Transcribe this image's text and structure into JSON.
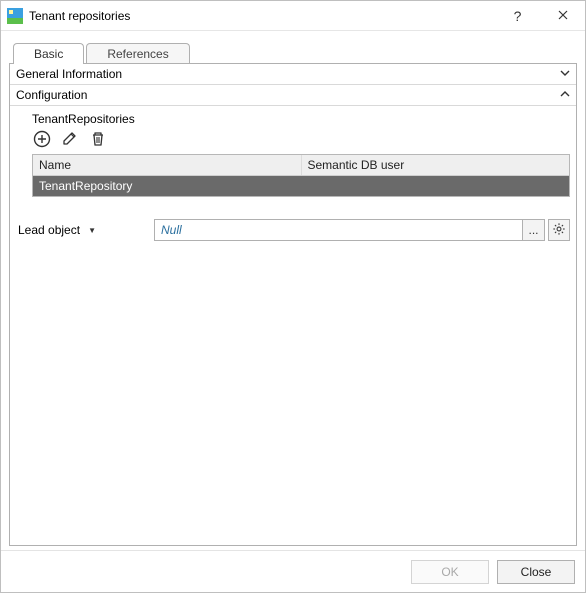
{
  "window": {
    "title": "Tenant repositories"
  },
  "titlebar": {
    "help_icon": "?",
    "close_icon": "✕"
  },
  "tabs": {
    "basic": "Basic",
    "references": "References"
  },
  "sections": {
    "general": {
      "title": "General Information"
    },
    "config": {
      "title": "Configuration"
    }
  },
  "config": {
    "subtitle": "TenantRepositories",
    "toolbar": {
      "add_icon": "add-circle",
      "edit_icon": "pencil",
      "delete_icon": "trash"
    },
    "table": {
      "columns": {
        "name": "Name",
        "db": "Semantic DB user"
      },
      "rows": [
        {
          "name": "TenantRepository",
          "db": ""
        }
      ]
    }
  },
  "lead": {
    "label": "Lead object",
    "value": "Null",
    "ellipsis": "...",
    "gear_icon": "gear"
  },
  "footer": {
    "ok": "OK",
    "close": "Close"
  },
  "colors": {
    "row_selected_bg": "#6a6a6a",
    "null_text": "#2a6f9e"
  }
}
